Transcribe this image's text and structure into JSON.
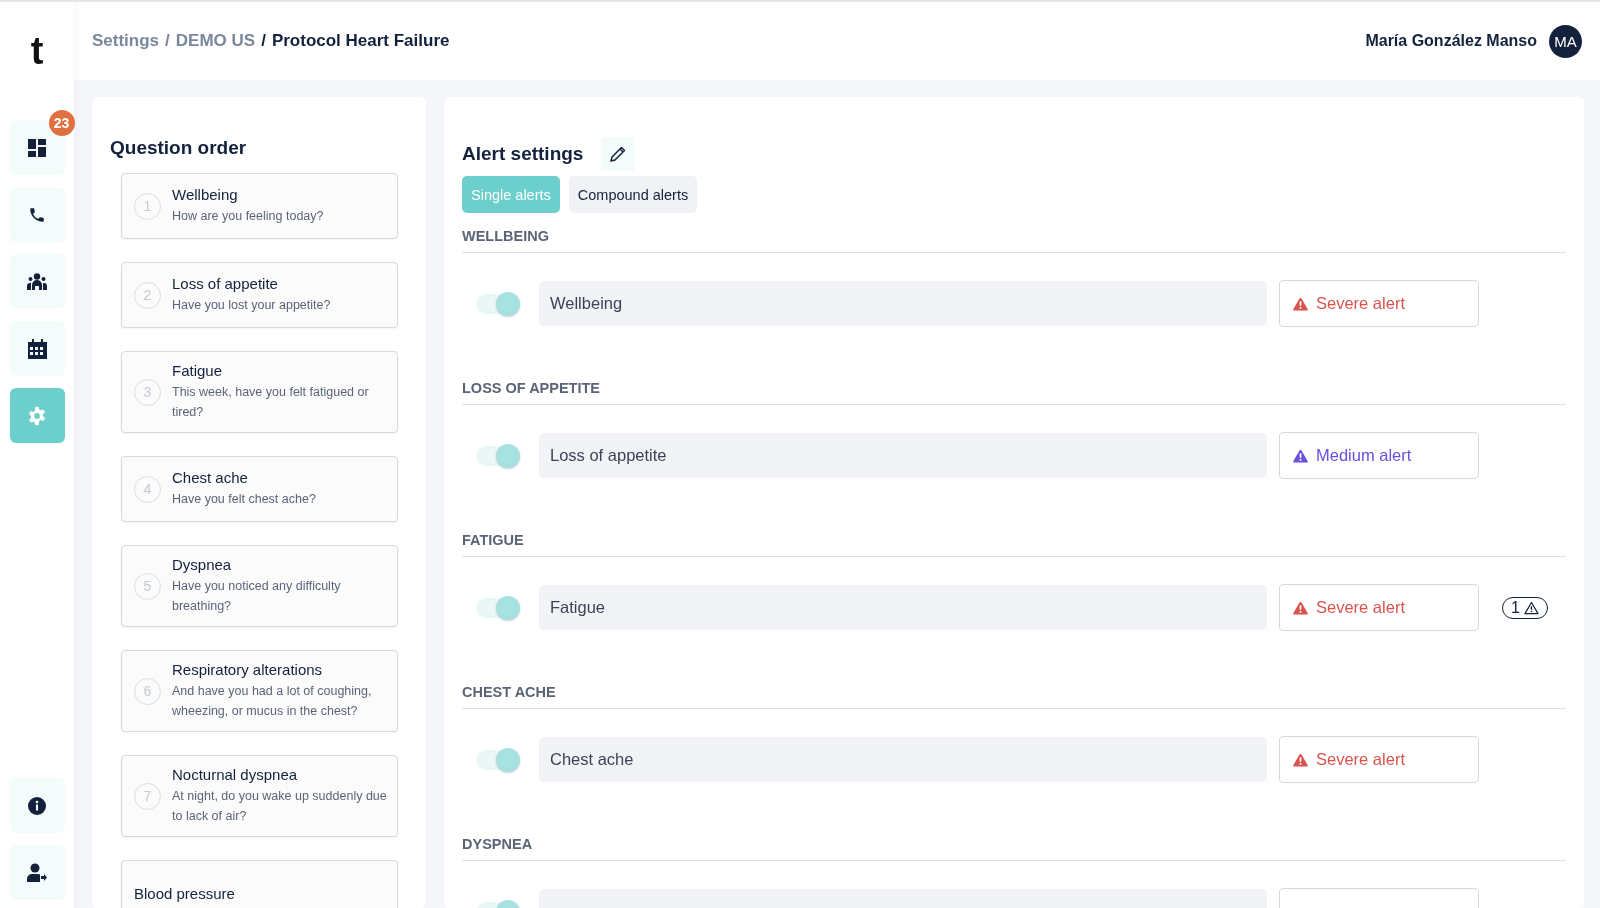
{
  "logo": "t",
  "sidebar": {
    "top_items": [
      {
        "selected": false,
        "badge": "23"
      },
      {
        "selected": false
      },
      {
        "selected": false
      },
      {
        "selected": false
      },
      {
        "selected": true
      }
    ],
    "bottom_items": [
      {
        "selected": false
      },
      {
        "selected": false
      }
    ]
  },
  "breadcrumb": [
    {
      "label": "Settings",
      "current": false
    },
    {
      "separator": "/",
      "label": "DEMO US",
      "current": false
    },
    {
      "separator": "/",
      "label": "Protocol Heart Failure",
      "current": true
    }
  ],
  "user": {
    "name": "María González Manso",
    "initials": "MA"
  },
  "question_order": {
    "title": "Question order",
    "items": [
      {
        "number": "1",
        "title": "Wellbeing",
        "question": "How are you feeling today?"
      },
      {
        "number": "2",
        "title": "Loss of appetite",
        "question": "Have you lost your appetite?"
      },
      {
        "number": "3",
        "title": "Fatigue",
        "question": "This week, have you felt fatigued or tired?"
      },
      {
        "number": "4",
        "title": "Chest ache",
        "question": "Have you felt chest ache?"
      },
      {
        "number": "5",
        "title": "Dyspnea",
        "question": "Have you noticed any difficulty breathing?"
      },
      {
        "number": "6",
        "title": "Respiratory alterations",
        "question": "And have you had a lot of coughing, wheezing, or mucus in the chest?"
      },
      {
        "number": "7",
        "title": "Nocturnal dyspnea",
        "question": "At night, do you wake up suddenly due to lack of air?"
      },
      {
        "title": "Blood pressure"
      }
    ]
  },
  "alert_settings": {
    "title": "Alert settings",
    "tabs": [
      {
        "label": "Single alerts",
        "selected": true
      },
      {
        "label": "Compound alerts",
        "selected": false
      }
    ],
    "sections": [
      {
        "heading": "WELLBEING",
        "on": true,
        "label": "Wellbeing",
        "color": "#d9534f",
        "alert": "Severe alert"
      },
      {
        "heading": "LOSS OF APPETITE",
        "on": true,
        "label": "Loss of appetite",
        "color": "#6c4fe0",
        "alert": "Medium alert"
      },
      {
        "heading": "FATIGUE",
        "on": true,
        "label": "Fatigue",
        "color": "#d9534f",
        "alert": "Severe alert",
        "compound_count": "1"
      },
      {
        "heading": "CHEST ACHE",
        "on": true,
        "label": "Chest ache",
        "color": "#d9534f",
        "alert": "Severe alert"
      },
      {
        "heading": "DYSPNEA",
        "on": true
      }
    ]
  }
}
